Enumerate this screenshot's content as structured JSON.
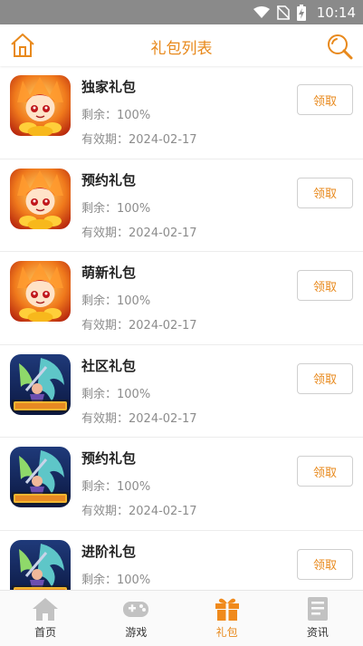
{
  "status_bar": {
    "time": "10:14"
  },
  "header": {
    "title": "礼包列表"
  },
  "gifts": [
    {
      "title": "独家礼包",
      "remaining": "剩余：100%",
      "valid": "有效期：2024-02-17",
      "button": "领取",
      "thumb": "fire-hero"
    },
    {
      "title": "预约礼包",
      "remaining": "剩余：100%",
      "valid": "有效期：2024-02-17",
      "button": "领取",
      "thumb": "fire-hero"
    },
    {
      "title": "萌新礼包",
      "remaining": "剩余：100%",
      "valid": "有效期：2024-02-17",
      "button": "领取",
      "thumb": "fire-hero"
    },
    {
      "title": "社区礼包",
      "remaining": "剩余：100%",
      "valid": "有效期：2024-02-17",
      "button": "领取",
      "thumb": "dragon"
    },
    {
      "title": "预约礼包",
      "remaining": "剩余：100%",
      "valid": "有效期：2024-02-17",
      "button": "领取",
      "thumb": "dragon"
    },
    {
      "title": "进阶礼包",
      "remaining": "剩余：100%",
      "valid": "",
      "button": "领取",
      "thumb": "dragon"
    }
  ],
  "tabbar": [
    {
      "label": "首页",
      "icon": "home-icon",
      "active": false
    },
    {
      "label": "游戏",
      "icon": "gamepad-icon",
      "active": false
    },
    {
      "label": "礼包",
      "icon": "gift-icon",
      "active": true
    },
    {
      "label": "资讯",
      "icon": "news-icon",
      "active": false
    }
  ],
  "colors": {
    "accent": "#e8891c",
    "status_bar": "#8a8a8a",
    "text": "#222222",
    "muted": "#8c8c8c"
  }
}
